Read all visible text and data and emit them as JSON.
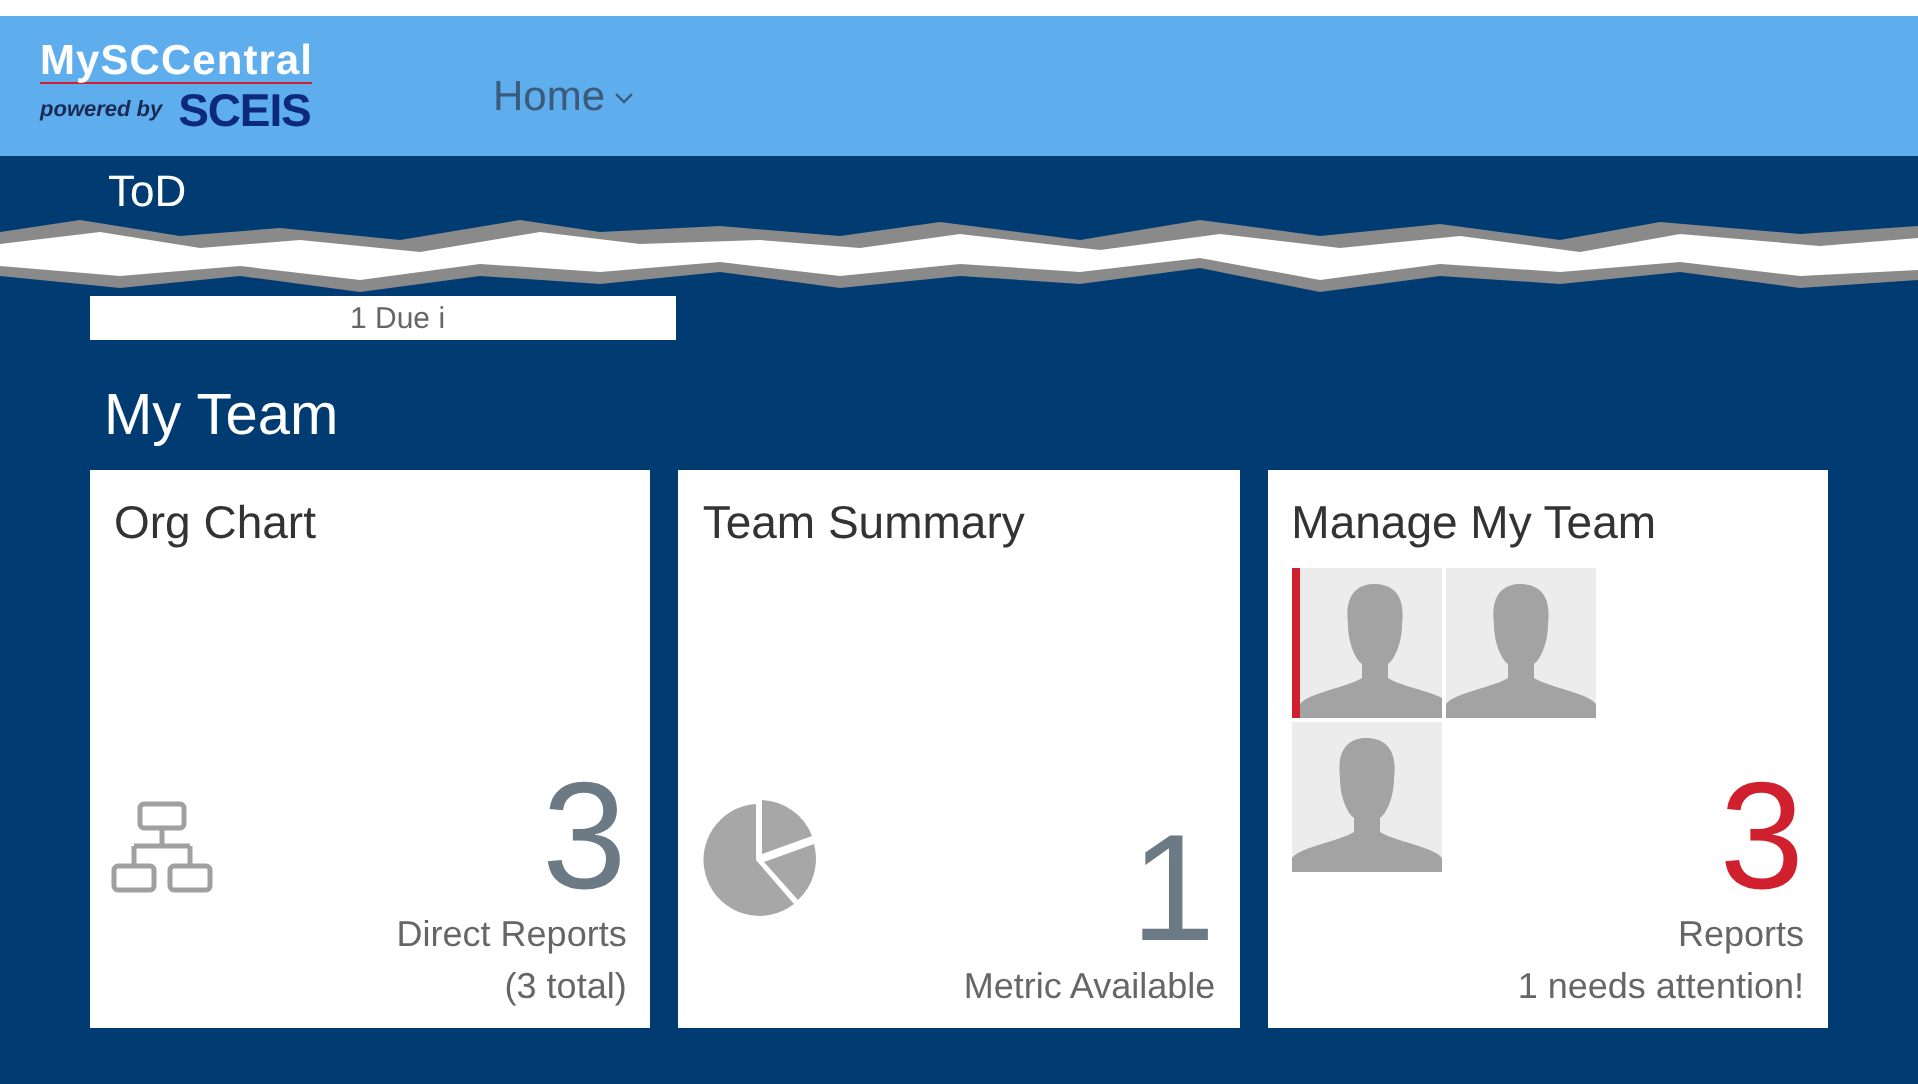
{
  "header": {
    "logo": {
      "name": "MySCCentral",
      "tagline": "powered by",
      "brand": "SCEIS"
    },
    "nav": [
      {
        "label": "Home"
      }
    ]
  },
  "todo": {
    "title": "ToD",
    "card_text": "1 Due i"
  },
  "my_team": {
    "title": "My Team",
    "tiles": [
      {
        "kind": "org",
        "title": "Org Chart",
        "count": "3",
        "alert": false,
        "lines": [
          "Direct Reports",
          "(3 total)"
        ]
      },
      {
        "kind": "summary",
        "title": "Team Summary",
        "count": "1",
        "alert": false,
        "lines": [
          "Metric Available"
        ]
      },
      {
        "kind": "manage",
        "title": "Manage My Team",
        "count": "3",
        "alert": true,
        "members": [
          {
            "attention": true
          },
          {
            "attention": false
          },
          {
            "attention": false
          }
        ],
        "lines": [
          "Reports",
          "1 needs attention!"
        ]
      }
    ]
  }
}
